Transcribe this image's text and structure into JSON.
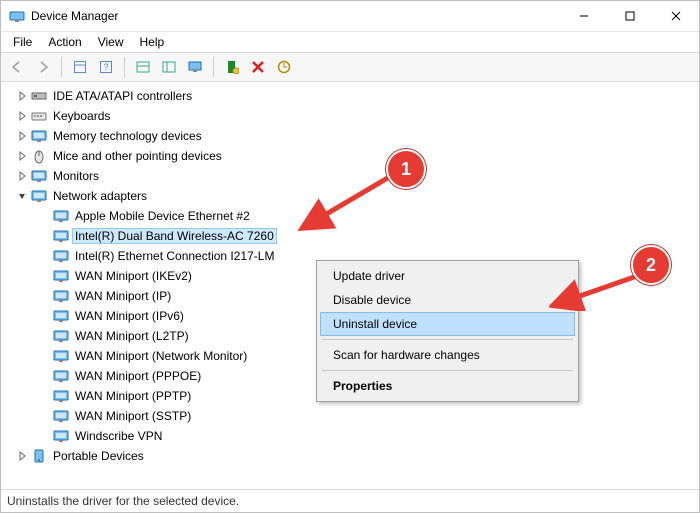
{
  "title": "Device Manager",
  "menus": [
    "File",
    "Action",
    "View",
    "Help"
  ],
  "tree": {
    "categories": [
      {
        "label": "IDE ATA/ATAPI controllers",
        "icon": "ide",
        "expanded": false
      },
      {
        "label": "Keyboards",
        "icon": "keyboard",
        "expanded": false
      },
      {
        "label": "Memory technology devices",
        "icon": "display",
        "expanded": false
      },
      {
        "label": "Mice and other pointing devices",
        "icon": "mouse",
        "expanded": false
      },
      {
        "label": "Monitors",
        "icon": "display",
        "expanded": false
      },
      {
        "label": "Network adapters",
        "icon": "net",
        "expanded": true,
        "children": [
          {
            "label": "Apple Mobile Device Ethernet #2"
          },
          {
            "label": "Intel(R) Dual Band Wireless-AC 7260",
            "selected": true
          },
          {
            "label": "Intel(R) Ethernet Connection I217-LM"
          },
          {
            "label": "WAN Miniport (IKEv2)"
          },
          {
            "label": "WAN Miniport (IP)"
          },
          {
            "label": "WAN Miniport (IPv6)"
          },
          {
            "label": "WAN Miniport (L2TP)"
          },
          {
            "label": "WAN Miniport (Network Monitor)"
          },
          {
            "label": "WAN Miniport (PPPOE)"
          },
          {
            "label": "WAN Miniport (PPTP)"
          },
          {
            "label": "WAN Miniport (SSTP)"
          },
          {
            "label": "Windscribe VPN"
          }
        ]
      },
      {
        "label": "Portable Devices",
        "icon": "portable",
        "expanded": false
      }
    ]
  },
  "context_menu": {
    "items": [
      {
        "label": "Update driver"
      },
      {
        "label": "Disable device"
      },
      {
        "label": "Uninstall device",
        "highlight": true
      },
      {
        "sep": true
      },
      {
        "label": "Scan for hardware changes"
      },
      {
        "sep": true
      },
      {
        "label": "Properties",
        "bold": true
      }
    ]
  },
  "status": "Uninstalls the driver for the selected device.",
  "callouts": {
    "c1": "1",
    "c2": "2"
  }
}
